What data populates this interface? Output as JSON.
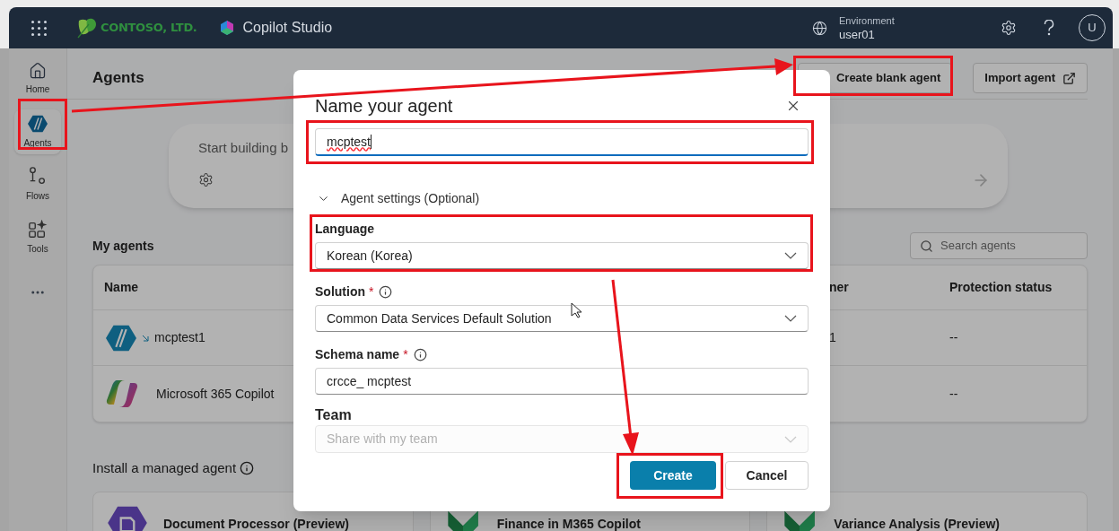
{
  "header": {
    "company": "CONTOSO, LTD.",
    "product": "Copilot Studio",
    "environment_label": "Environment",
    "environment": "user01",
    "avatar": "U"
  },
  "nav": [
    {
      "label": "Home",
      "kind": "home",
      "selected": false
    },
    {
      "label": "Agents",
      "kind": "agents",
      "selected": true
    },
    {
      "label": "Flows",
      "kind": "flows",
      "selected": false
    },
    {
      "label": "Tools",
      "kind": "tools",
      "selected": false
    }
  ],
  "page": {
    "title": "Agents",
    "actions": [
      {
        "label": "Create blank agent",
        "kind": "plain"
      },
      {
        "label": "Import agent",
        "kind": "external"
      }
    ],
    "hero": {
      "text": "Start building b"
    },
    "my_agents": {
      "title": "My agents",
      "search_placeholder": "Search agents"
    },
    "table": {
      "columns": [
        "Name",
        "ner",
        "Protection status"
      ],
      "rows": [
        {
          "kind": "agent",
          "name": "mcptest1",
          "owner": "1",
          "protection": "--",
          "new": true
        },
        {
          "kind": "copilot",
          "name": "Microsoft 365 Copilot",
          "protection": "--",
          "new": false
        }
      ]
    },
    "managed": {
      "title": "Install a managed agent",
      "cards": [
        {
          "kind": "document",
          "title": "Document Processor (Preview)"
        },
        {
          "kind": "finance",
          "title": "Finance in M365 Copilot"
        },
        {
          "kind": "finance",
          "title": "Variance Analysis (Preview)"
        }
      ]
    }
  },
  "dialog": {
    "title": "Name your agent",
    "name_value": "mcptest",
    "section": {
      "label": "Agent settings (Optional)",
      "expanded": true
    },
    "fields": [
      {
        "kind": "select",
        "label": "Language",
        "value": "Korean (Korea)",
        "info": false,
        "disabled": false
      },
      {
        "kind": "select",
        "label": "Solution",
        "required_mark": "*",
        "info": true,
        "value": "Common Data Services Default Solution",
        "disabled": false
      },
      {
        "kind": "text",
        "label": "Schema name",
        "required_mark": "*",
        "info": true,
        "value": "crcce_ mcptest",
        "disabled": false
      },
      {
        "kind": "select",
        "label": "Team",
        "placeholder": "Share with my team",
        "info": false,
        "disabled": true
      }
    ],
    "buttons": [
      {
        "label": "Create",
        "kind": "primary"
      },
      {
        "label": "Cancel",
        "kind": "secondary"
      }
    ]
  }
}
